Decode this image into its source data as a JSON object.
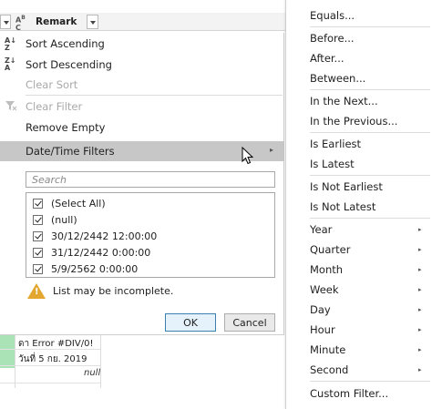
{
  "header": {
    "column_title": "Remark",
    "type_icon_text": "ABC"
  },
  "background_rows": [
    {
      "text": "ดา Error #DIV/0!"
    },
    {
      "text": "วันที่ 5 กย. 2019"
    },
    {
      "text": "null"
    }
  ],
  "filter_menu": {
    "sort_ascending": "Sort Ascending",
    "sort_descending": "Sort Descending",
    "clear_sort": "Clear Sort",
    "clear_filter": "Clear Filter",
    "remove_empty": "Remove Empty",
    "datetime_filters": "Date/Time Filters",
    "search_placeholder": "Search",
    "values": [
      {
        "label": "(Select All)",
        "checked": true
      },
      {
        "label": "(null)",
        "checked": true
      },
      {
        "label": "30/12/2442 12:00:00",
        "checked": true
      },
      {
        "label": "31/12/2442 0:00:00",
        "checked": true
      },
      {
        "label": "5/9/2562 0:00:00",
        "checked": true
      }
    ],
    "warning": "List may be incomplete.",
    "ok_label": "OK",
    "cancel_label": "Cancel"
  },
  "submenu": {
    "items": [
      {
        "label": "Equals...",
        "arrow": false
      },
      {
        "label": "Before...",
        "arrow": false
      },
      {
        "label": "After...",
        "arrow": false
      },
      {
        "label": "Between...",
        "arrow": false
      },
      {
        "label": "In the Next...",
        "arrow": false
      },
      {
        "label": "In the Previous...",
        "arrow": false
      },
      {
        "label": "Is Earliest",
        "arrow": false
      },
      {
        "label": "Is Latest",
        "arrow": false
      },
      {
        "label": "Is Not Earliest",
        "arrow": false
      },
      {
        "label": "Is Not Latest",
        "arrow": false
      },
      {
        "label": "Year",
        "arrow": true
      },
      {
        "label": "Quarter",
        "arrow": true
      },
      {
        "label": "Month",
        "arrow": true
      },
      {
        "label": "Week",
        "arrow": true
      },
      {
        "label": "Day",
        "arrow": true
      },
      {
        "label": "Hour",
        "arrow": true
      },
      {
        "label": "Minute",
        "arrow": true
      },
      {
        "label": "Second",
        "arrow": true
      },
      {
        "label": "Custom Filter...",
        "arrow": false
      }
    ]
  },
  "colors": {
    "highlight": "#c7c7c7",
    "warning": "#e3a72f",
    "green_cell": "#a9e3b6",
    "ok_border": "#3c7fb1"
  }
}
